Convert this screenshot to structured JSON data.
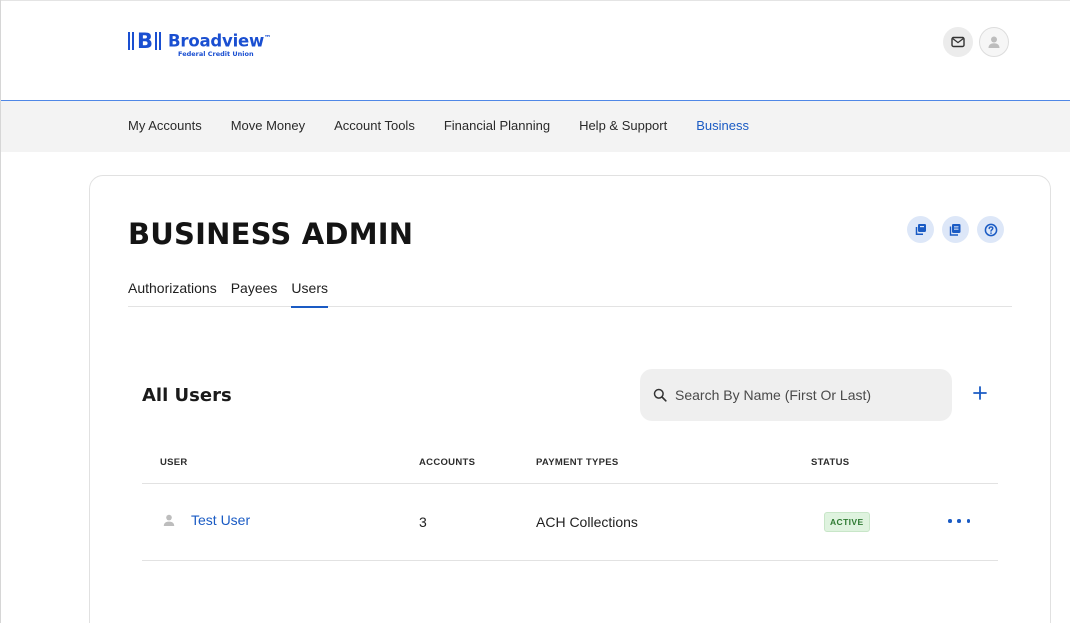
{
  "header": {
    "logo_mark": "B",
    "logo_name": "Broadview",
    "logo_tm": "™",
    "logo_subtitle": "Federal Credit Union",
    "icons": [
      "mail-icon",
      "user-icon"
    ]
  },
  "nav": {
    "items": [
      {
        "label": "My Accounts",
        "active": false
      },
      {
        "label": "Move Money",
        "active": false
      },
      {
        "label": "Account Tools",
        "active": false
      },
      {
        "label": "Financial Planning",
        "active": false
      },
      {
        "label": "Help & Support",
        "active": false
      },
      {
        "label": "Business",
        "active": true
      }
    ]
  },
  "page": {
    "title": "BUSINESS ADMIN",
    "tool_icons": [
      "copy-icon",
      "document-icon",
      "help-icon"
    ],
    "tabs": [
      {
        "label": "Authorizations",
        "active": false
      },
      {
        "label": "Payees",
        "active": false
      },
      {
        "label": "Users",
        "active": true
      }
    ]
  },
  "users": {
    "section_title": "All Users",
    "search_placeholder": "Search By Name (First Or Last)",
    "add_icon": "plus-icon",
    "columns": {
      "user": "USER",
      "accounts": "ACCOUNTS",
      "payment_types": "PAYMENT TYPES",
      "status": "STATUS"
    },
    "rows": [
      {
        "name": "Test User",
        "accounts": "3",
        "payment_types": "ACH Collections",
        "status": "ACTIVE"
      }
    ]
  },
  "colors": {
    "brand_blue": "#1a4fd1",
    "link_blue": "#1a5bc4",
    "nav_bg": "#f3f3f3",
    "status_active_bg": "#dff3df",
    "status_active_text": "#2e7a32"
  }
}
